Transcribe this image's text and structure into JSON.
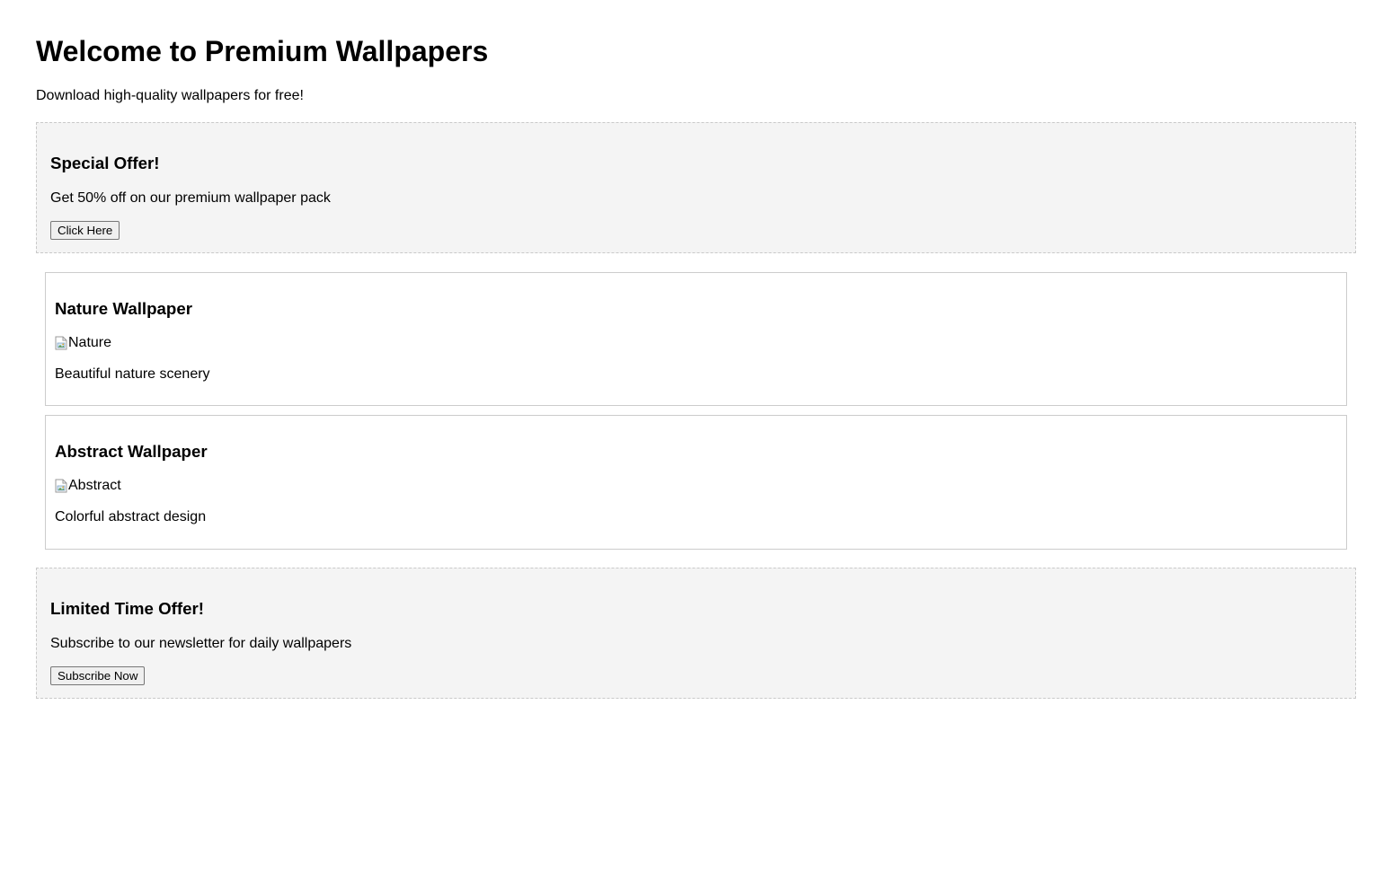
{
  "header": {
    "title": "Welcome to Premium Wallpapers",
    "subtitle": "Download high-quality wallpapers for free!"
  },
  "offers": [
    {
      "title": "Special Offer!",
      "text": "Get 50% off on our premium wallpaper pack",
      "button_label": "Click Here"
    },
    {
      "title": "Limited Time Offer!",
      "text": "Subscribe to our newsletter for daily wallpapers",
      "button_label": "Subscribe Now"
    }
  ],
  "wallpapers": [
    {
      "title": "Nature Wallpaper",
      "image_alt": "Nature",
      "description": "Beautiful nature scenery",
      "icon": "broken-image-icon"
    },
    {
      "title": "Abstract Wallpaper",
      "image_alt": "Abstract",
      "description": "Colorful abstract design",
      "icon": "broken-image-icon"
    }
  ],
  "colors": {
    "offer_background": "#f4f4f4",
    "offer_border": "#c9c9c9",
    "card_border": "#cccccc",
    "text": "#000000"
  }
}
